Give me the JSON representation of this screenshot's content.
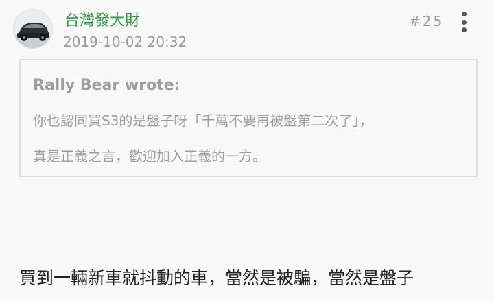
{
  "post": {
    "author": "台灣發大財",
    "timestamp": "2019-10-02 20:32",
    "post_number": "#25",
    "avatar_icon": "car-avatar-icon",
    "menu_icon": "more-vertical-icon"
  },
  "quote": {
    "author_line": "Rally Bear wrote:",
    "lines": [
      "你也認同買S3的是盤子呀「千萬不要再被盤第二次了」，",
      "真是正義之言，歡迎加入正義的一方。"
    ]
  },
  "content": {
    "text": "買到一輛新車就抖動的車，當然是被騙，當然是盤子"
  },
  "colors": {
    "author": "#2e9a3e",
    "muted": "#9a9a9a",
    "quote_border": "#dedede",
    "body_text": "#222222"
  }
}
